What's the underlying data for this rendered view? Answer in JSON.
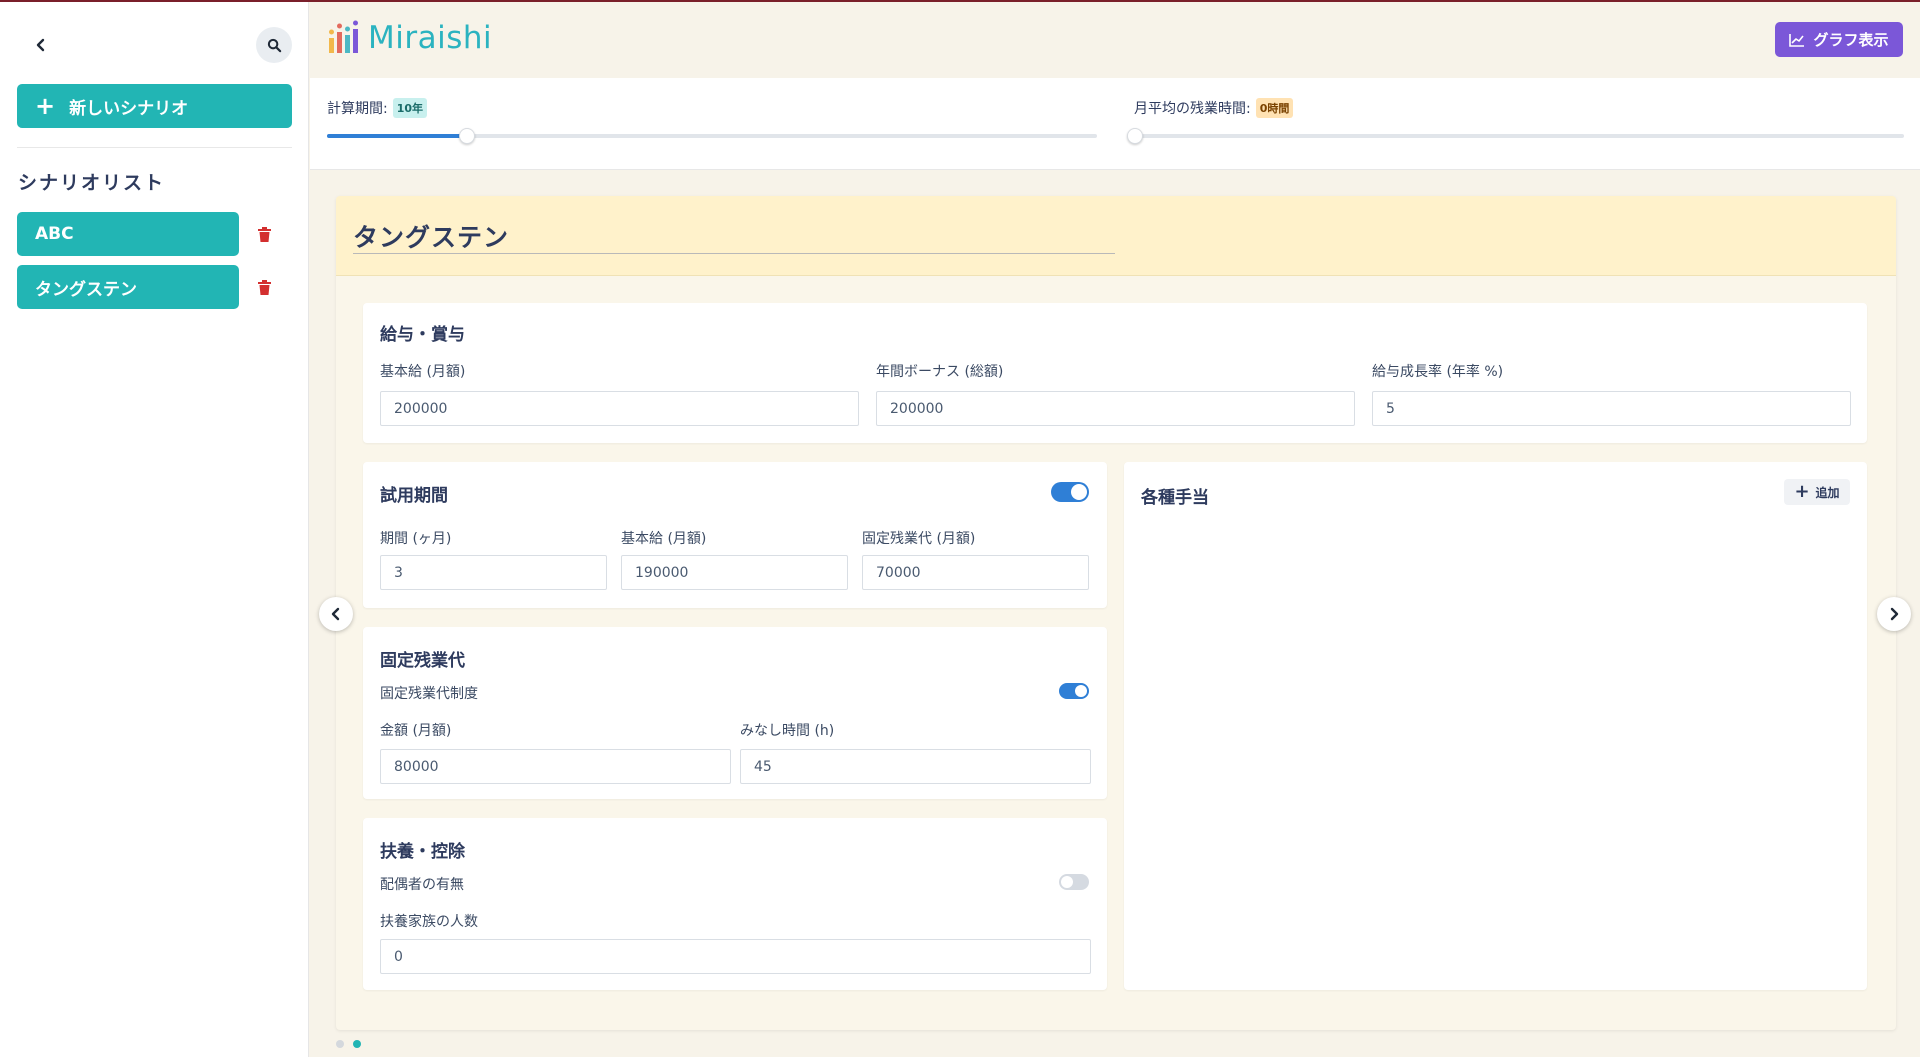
{
  "app": {
    "name": "Miraishi"
  },
  "header": {
    "graph_button": "グラフ表示"
  },
  "sidebar": {
    "new_scenario": "新しいシナリオ",
    "list_title": "シナリオリスト",
    "scenarios": [
      {
        "label": "ABC"
      },
      {
        "label": "タングステン"
      }
    ]
  },
  "sliders": {
    "period": {
      "label": "計算期間:",
      "badge": "10年",
      "fraction": 0.18
    },
    "overtime": {
      "label": "月平均の残業時間:",
      "badge": "0時間",
      "fraction": 0.0
    }
  },
  "scenario": {
    "title": "タングステン"
  },
  "salary": {
    "title": "給与・賞与",
    "base_label": "基本給 (月額)",
    "base_value": "200000",
    "bonus_label": "年間ボーナス (総額)",
    "bonus_value": "200000",
    "growth_label": "給与成長率 (年率 %)",
    "growth_value": "5"
  },
  "trial": {
    "title": "試用期間",
    "enabled": true,
    "period_label": "期間 (ヶ月)",
    "period_value": "3",
    "base_label": "基本給 (月額)",
    "base_value": "190000",
    "overtime_label": "固定残業代 (月額)",
    "overtime_value": "70000"
  },
  "fixed_overtime": {
    "title": "固定残業代",
    "system_label": "固定残業代制度",
    "enabled": true,
    "amount_label": "金額 (月額)",
    "amount_value": "80000",
    "hours_label": "みなし時間 (h)",
    "hours_value": "45"
  },
  "dependents": {
    "title": "扶養・控除",
    "spouse_label": "配偶者の有無",
    "spouse_enabled": false,
    "count_label": "扶養家族の人数",
    "count_value": "0"
  },
  "allowances": {
    "title": "各種手当",
    "add_button": "追加"
  },
  "colors": {
    "accent_teal": "#22b5b4",
    "accent_purple": "#7b57d8",
    "toggle_on": "#2f7fd6",
    "delete_red": "#d32f2f"
  },
  "pagination": {
    "pages": 2,
    "current": 2
  }
}
